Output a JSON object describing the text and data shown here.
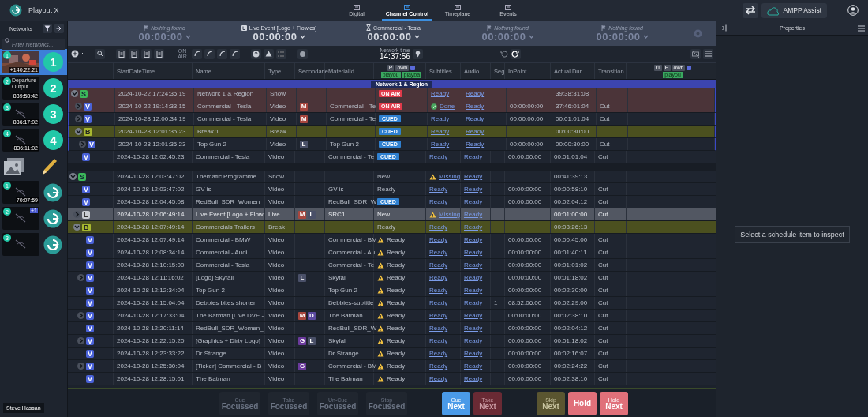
{
  "app": {
    "title": "Playout X"
  },
  "nav": [
    {
      "label": "Digital",
      "selected": false
    },
    {
      "label": "Channel Control",
      "selected": true
    },
    {
      "label": "Timeplane",
      "selected": false
    },
    {
      "label": "Events",
      "selected": false
    }
  ],
  "assist_button": "AMPP Assist",
  "sidebar": {
    "title": "Networks",
    "search": {
      "placeholder": "Filter Networks..."
    },
    "networks": [
      {
        "kind": "channel",
        "badge": "1",
        "time": "+140:22:21",
        "number": "1",
        "selected": true
      },
      {
        "kind": "channel",
        "thumb": {
          "kind": "broken",
          "alt": "Departure Output"
        },
        "badge": "2",
        "time": "839:58:42",
        "number": "2",
        "selected": false
      },
      {
        "kind": "channel",
        "thumb": {
          "kind": "blank"
        },
        "badge": "3",
        "time": "836:17:02",
        "number": "3",
        "selected": false
      },
      {
        "kind": "channel",
        "thumb": {
          "kind": "blank"
        },
        "badge": "4",
        "time": "836:11:02",
        "number": "4",
        "selected": false
      },
      {
        "kind": "tool",
        "selected": false
      },
      {
        "kind": "gv",
        "thumb": {
          "kind": "blank"
        },
        "badge": "1",
        "time": "70:07:59",
        "selected": false
      },
      {
        "kind": "gv",
        "thumb": {
          "kind": "blank"
        },
        "badge": "2",
        "extra": "+1",
        "selected": false
      },
      {
        "kind": "gv",
        "thumb": {
          "kind": "blank"
        },
        "badge": "3",
        "selected": false
      }
    ],
    "user": "Steve Hassan"
  },
  "countdowns": [
    {
      "kind": "empty",
      "label": "Nothing found",
      "time": "00:00:00"
    },
    {
      "kind": "live",
      "label": "Live Event [Logo + Flowics]",
      "time": "00:00:00"
    },
    {
      "kind": "video",
      "label": "Commercial - Tesla",
      "time": "00:00:00"
    },
    {
      "kind": "empty",
      "label": "Nothing found",
      "time": "00:00:00"
    },
    {
      "kind": "empty",
      "label": "Nothing found",
      "time": "00:00:00"
    }
  ],
  "toolbar": {
    "on_air_label": "ON AIR",
    "network_time_label": "Network time",
    "network_time": "14:37:56"
  },
  "table": {
    "columns": [
      "StartDateTime",
      "Name",
      "Type",
      "Secondarie",
      "MaterialId",
      "Subtitles",
      "Audio",
      "Seg",
      "InPoint",
      "Actual Dur",
      "Transition"
    ],
    "status_header": {
      "tags": [
        "P",
        "own"
      ],
      "chips": [
        "playou",
        "playba"
      ]
    },
    "extra_header": {
      "tags": [
        "r1",
        "P",
        "own"
      ],
      "chips": [
        "playou"
      ]
    },
    "group_banner": "Network 1 & Region",
    "rows": [
      {
        "kind": "show",
        "letter": "S",
        "has_toggle": true,
        "expanded": true,
        "on_air": true,
        "focused": true,
        "start": "2024-10-22 17:24:35:19",
        "name": "Network 1 & Region",
        "type": "Show",
        "status": {
          "kind": "on_air",
          "text": "ON AIR"
        },
        "subtitles": {
          "kind": "link",
          "text": "Ready"
        },
        "audio": "Ready",
        "actual_dur": "39:38:31:08",
        "children": [
          {
            "kind": "video",
            "letter": "V",
            "has_toggle": true,
            "expanded": false,
            "on_air": true,
            "focused": true,
            "start": "2024-10-22 19:14:33:15",
            "name": "Commercial - Tesla",
            "type": "Video",
            "secondaries": [
              {
                "letter": "M",
                "color": "#a8473f"
              }
            ],
            "material": "Commercial - Te",
            "status": {
              "kind": "on_air",
              "text": "ON AIR"
            },
            "subtitles": {
              "kind": "done",
              "text": "Done"
            },
            "audio": "Ready",
            "inpoint": "00:00:00:00",
            "actual_dur": "37:46:01:04",
            "transition": "Cut"
          },
          {
            "kind": "video",
            "letter": "V",
            "has_toggle": true,
            "expanded": false,
            "on_air": false,
            "focused": true,
            "start": "2024-10-28 12:00:34:19",
            "name": "Commercial - Tesla",
            "type": "Video",
            "secondaries": [
              {
                "letter": "M",
                "color": "#a8473f"
              }
            ],
            "material": "Commercial - Te",
            "status": {
              "kind": "cued",
              "text": "CUED"
            },
            "subtitles": {
              "kind": "link",
              "text": "Ready"
            },
            "audio": "Ready",
            "inpoint": "00:00:00:00",
            "actual_dur": "00:01:01:04",
            "transition": "Cut"
          },
          {
            "kind": "break",
            "letter": "B",
            "has_toggle": true,
            "expanded": true,
            "on_air": false,
            "focused": true,
            "start": "2024-10-28 12:01:35:23",
            "name": "Break 1",
            "type": "Break",
            "status": {
              "kind": "cued",
              "text": "CUED"
            },
            "subtitles": {
              "kind": "link",
              "text": "Ready"
            },
            "audio": "Ready",
            "actual_dur": "00:00:30:00",
            "children": [
              {
                "kind": "video",
                "letter": "V",
                "has_toggle": true,
                "expanded": false,
                "on_air": false,
                "focused": true,
                "start": "2024-10-28 12:01:35:23",
                "name": "Top Gun 2",
                "type": "Video",
                "secondaries": [
                  {
                    "letter": "L",
                    "color": "#4a5068"
                  }
                ],
                "material": "Top Gun 2",
                "status": {
                  "kind": "cued",
                  "text": "CUED"
                },
                "subtitles": {
                  "kind": "link",
                  "text": "Ready"
                },
                "audio": "Ready",
                "inpoint": "00:00:00:00",
                "actual_dur": "00:00:30:00",
                "transition": "Cut"
              }
            ]
          },
          {
            "kind": "video",
            "letter": "V",
            "has_toggle": false,
            "expanded": false,
            "on_air": false,
            "focused": false,
            "start": "2024-10-28 12:02:45:23",
            "name": "Commercial - Tesla",
            "type": "Video",
            "material": "Commercial - Te",
            "status": {
              "kind": "cued",
              "text": "CUED"
            },
            "subtitles": {
              "kind": "link",
              "text": "Ready"
            },
            "audio": "Ready",
            "inpoint": "00:00:00:00",
            "actual_dur": "00:01:01:04",
            "transition": "Cut"
          }
        ]
      },
      {
        "kind": "show",
        "letter": "S",
        "has_toggle": true,
        "expanded": true,
        "on_air": false,
        "focused": false,
        "start": "2024-10-28 12:03:47:02",
        "name": "Thematic Programme",
        "type": "Show",
        "status": {
          "kind": "text",
          "text": "New"
        },
        "subtitles": {
          "kind": "missing",
          "text": "Missing"
        },
        "audio": "Ready",
        "actual_dur": "00:41:39:13",
        "children": [
          {
            "kind": "video",
            "letter": "V",
            "has_toggle": false,
            "expanded": false,
            "on_air": false,
            "focused": false,
            "start": "2024-10-28 12:03:47:02",
            "name": "GV is",
            "type": "Video",
            "material": "GV is",
            "status": {
              "kind": "text",
              "text": "Ready"
            },
            "subtitles": {
              "kind": "link",
              "text": "Ready"
            },
            "audio": "Ready",
            "inpoint": "00:00:00:00",
            "actual_dur": "00:00:58:10",
            "transition": "Cut"
          },
          {
            "kind": "video",
            "letter": "V",
            "has_toggle": false,
            "expanded": false,
            "on_air": false,
            "focused": false,
            "start": "2024-10-28 12:04:45:08",
            "name": "RedBull_SDR_Women_",
            "type": "Video",
            "material": "RedBull_SDR_W",
            "status": {
              "kind": "cued",
              "text": "CUED"
            },
            "subtitles": {
              "kind": "link",
              "text": "Ready"
            },
            "audio": "Ready",
            "inpoint": "00:00:00:00",
            "actual_dur": "00:02:04:12",
            "transition": "Cut"
          },
          {
            "kind": "live",
            "letter": "L",
            "has_toggle": true,
            "expanded": false,
            "on_air": false,
            "focused": false,
            "start": "2024-10-28 12:06:49:14",
            "name": "Live Event [Logo + Flow",
            "type": "Live",
            "secondaries": [
              {
                "letter": "M",
                "color": "#a8473f"
              },
              {
                "letter": "L",
                "color": "#4a5068"
              }
            ],
            "material": "SRC1",
            "status": {
              "kind": "text",
              "text": "New"
            },
            "subtitles": {
              "kind": "missing",
              "text": "Missing"
            },
            "audio": "Ready",
            "actual_dur": "00:01:00:00",
            "transition": "Cut"
          },
          {
            "kind": "break",
            "letter": "B",
            "has_toggle": true,
            "expanded": true,
            "on_air": false,
            "focused": false,
            "start": "2024-10-28 12:07:49:14",
            "name": "Commercials Trailers",
            "type": "Break",
            "status": {
              "kind": "text",
              "text": "Ready"
            },
            "subtitles": {
              "kind": "link",
              "text": "Ready"
            },
            "audio": "Ready",
            "actual_dur": "00:03:26:13",
            "children": [
              {
                "kind": "video",
                "letter": "V",
                "has_toggle": false,
                "expanded": false,
                "on_air": false,
                "focused": false,
                "start": "2024-10-28 12:07:49:14",
                "name": "Commercial - BMW",
                "type": "Video",
                "material": "Commercial - BM",
                "status": {
                  "kind": "warn",
                  "text": "Ready"
                },
                "subtitles": {
                  "kind": "link",
                  "text": "Ready"
                },
                "audio": "Ready",
                "inpoint": "00:00:00:00",
                "actual_dur": "00:00:45:00",
                "transition": "Cut"
              },
              {
                "kind": "video",
                "letter": "V",
                "has_toggle": false,
                "expanded": false,
                "on_air": false,
                "focused": false,
                "start": "2024-10-28 12:08:34:14",
                "name": "Commercial - Audi",
                "type": "Video",
                "material": "Commercial - Au",
                "status": {
                  "kind": "warn",
                  "text": "Ready"
                },
                "subtitles": {
                  "kind": "link",
                  "text": "Ready"
                },
                "audio": "Ready",
                "inpoint": "00:00:00:00",
                "actual_dur": "00:01:40:11",
                "transition": "Cut"
              },
              {
                "kind": "video",
                "letter": "V",
                "has_toggle": false,
                "expanded": false,
                "on_air": false,
                "focused": false,
                "start": "2024-10-28 12:10:15:00",
                "name": "Commercial - Tesla",
                "type": "Video",
                "material": "Commercial - Te",
                "status": {
                  "kind": "warn",
                  "text": "Ready"
                },
                "subtitles": {
                  "kind": "link",
                  "text": "Ready"
                },
                "audio": "Ready",
                "inpoint": "00:00:00:00",
                "actual_dur": "00:01:01:02",
                "transition": "Cut"
              },
              {
                "kind": "video",
                "letter": "V",
                "has_toggle": true,
                "expanded": false,
                "on_air": false,
                "focused": false,
                "start": "2024-10-28 12:11:16:02",
                "name": "[Logo] Skyfall",
                "type": "Video",
                "secondaries": [
                  {
                    "letter": "L",
                    "color": "#4a5068"
                  }
                ],
                "material": "Skyfall",
                "status": {
                  "kind": "warn",
                  "text": "Ready"
                },
                "subtitles": {
                  "kind": "link",
                  "text": "Ready"
                },
                "audio": "Ready",
                "inpoint": "00:00:00:00",
                "actual_dur": "00:01:18:02",
                "transition": "Cut"
              },
              {
                "kind": "video",
                "letter": "V",
                "has_toggle": false,
                "expanded": false,
                "on_air": false,
                "focused": false,
                "start": "2024-10-28 12:12:34:04",
                "name": "Top Gun 2",
                "type": "Video",
                "material": "Top Gun 2",
                "status": {
                  "kind": "warn",
                  "text": "Ready"
                },
                "subtitles": {
                  "kind": "link",
                  "text": "Ready"
                },
                "audio": "Ready",
                "inpoint": "00:00:00:00",
                "actual_dur": "00:02:30:00",
                "transition": "Cut"
              },
              {
                "kind": "video",
                "letter": "V",
                "has_toggle": false,
                "expanded": false,
                "on_air": false,
                "focused": false,
                "start": "2024-10-28 12:15:04:04",
                "name": "Debbies bites shorter",
                "type": "Video",
                "material": "Debbies-subtitle",
                "status": {
                  "kind": "warn",
                  "text": "Ready"
                },
                "subtitles": {
                  "kind": "link",
                  "text": "Ready"
                },
                "audio": "Ready",
                "seg": "1",
                "inpoint": "08:52:06:00",
                "actual_dur": "00:02:29:00",
                "transition": "Cut"
              },
              {
                "kind": "video",
                "letter": "V",
                "has_toggle": true,
                "expanded": false,
                "on_air": false,
                "focused": false,
                "start": "2024-10-28 12:17:33:04",
                "name": "The Batman [Live DVE -",
                "type": "Video",
                "secondaries": [
                  {
                    "letter": "M",
                    "color": "#a8473f"
                  },
                  {
                    "letter": "D",
                    "color": "#5b4aa0"
                  }
                ],
                "material": "The Batman",
                "status": {
                  "kind": "warn",
                  "text": "Ready"
                },
                "subtitles": {
                  "kind": "link",
                  "text": "Ready"
                },
                "audio": "Ready",
                "inpoint": "00:00:00:00",
                "actual_dur": "00:02:38:10",
                "transition": "Cut"
              },
              {
                "kind": "video",
                "letter": "V",
                "has_toggle": false,
                "expanded": false,
                "on_air": false,
                "focused": false,
                "start": "2024-10-28 12:20:11:14",
                "name": "RedBull_SDR_Women_",
                "type": "Video",
                "material": "RedBull_SDR_W",
                "status": {
                  "kind": "warn",
                  "text": "Ready"
                },
                "subtitles": {
                  "kind": "link",
                  "text": "Ready"
                },
                "audio": "Ready",
                "inpoint": "00:00:00:00",
                "actual_dur": "00:02:04:12",
                "transition": "Cut"
              },
              {
                "kind": "video",
                "letter": "V",
                "has_toggle": true,
                "expanded": false,
                "on_air": false,
                "focused": false,
                "start": "2024-10-28 12:22:15:20",
                "name": "[Graphics + Dirty Logo]",
                "type": "Video",
                "secondaries": [
                  {
                    "letter": "G",
                    "color": "#6b3a9c"
                  },
                  {
                    "letter": "L",
                    "color": "#4a5068"
                  }
                ],
                "material": "Skyfall",
                "status": {
                  "kind": "warn",
                  "text": "Ready"
                },
                "subtitles": {
                  "kind": "link",
                  "text": "Ready"
                },
                "audio": "Ready",
                "inpoint": "00:00:00:00",
                "actual_dur": "00:01:18:02",
                "transition": "Cut"
              },
              {
                "kind": "video",
                "letter": "V",
                "has_toggle": false,
                "expanded": false,
                "on_air": false,
                "focused": false,
                "start": "2024-10-28 12:23:33:22",
                "name": "Dr Strange",
                "type": "Video",
                "material": "Dr Strange",
                "status": {
                  "kind": "warn",
                  "text": "Ready"
                },
                "subtitles": {
                  "kind": "link",
                  "text": "Ready"
                },
                "audio": "Ready",
                "inpoint": "00:00:00:00",
                "actual_dur": "00:02:16:07",
                "transition": "Cut"
              },
              {
                "kind": "video",
                "letter": "V",
                "has_toggle": true,
                "expanded": false,
                "on_air": false,
                "focused": false,
                "start": "2024-10-28 12:25:30:04",
                "name": "[Ticker] Commercial - B",
                "type": "Video",
                "secondaries": [
                  {
                    "letter": "G",
                    "color": "#6b3a9c"
                  }
                ],
                "material": "Commercial - BM",
                "status": {
                  "kind": "warn",
                  "text": "Ready"
                },
                "subtitles": {
                  "kind": "link",
                  "text": "Ready"
                },
                "audio": "Ready",
                "inpoint": "00:00:00:00",
                "actual_dur": "00:02:24:22",
                "transition": "Cut"
              },
              {
                "kind": "video",
                "letter": "V",
                "has_toggle": false,
                "expanded": false,
                "on_air": false,
                "focused": false,
                "start": "2024-10-28 12:28:15:01",
                "name": "The Batman",
                "type": "Video",
                "material": "The Batman",
                "status": {
                  "kind": "warn",
                  "text": "Ready"
                },
                "subtitles": {
                  "kind": "link",
                  "text": "Ready"
                },
                "audio": "Ready",
                "inpoint": "00:00:00:00",
                "actual_dur": "00:02:38:10",
                "transition": "Cut"
              }
            ]
          }
        ]
      }
    ]
  },
  "properties": {
    "title": "Properties",
    "empty_message": "Select a schedule item to inspect"
  },
  "actions": [
    {
      "kind": "ghost",
      "top": "Cue",
      "label": "Focussed"
    },
    {
      "kind": "ghost",
      "top": "Take",
      "label": "Focussed"
    },
    {
      "kind": "ghost",
      "top": "Un-Cue",
      "label": "Focussed"
    },
    {
      "kind": "ghost",
      "top": "Stop",
      "label": "Focussed"
    },
    {
      "kind": "cue",
      "top": "Cue",
      "label": "Next"
    },
    {
      "kind": "take",
      "top": "Take",
      "label": "Next"
    },
    {
      "kind": "skip",
      "top": "Skip",
      "label": "Next"
    },
    {
      "kind": "hold",
      "label": "Hold"
    },
    {
      "kind": "hold",
      "top": "Hold",
      "label": "Next"
    }
  ]
}
